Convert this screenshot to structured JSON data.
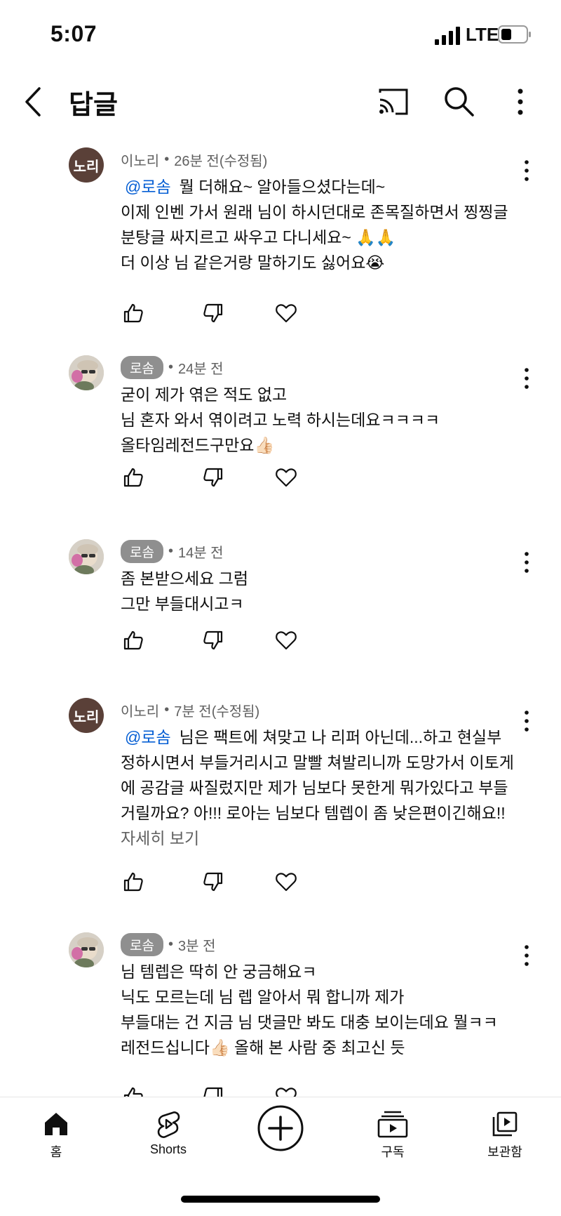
{
  "status": {
    "time": "5:07",
    "network": "LTE"
  },
  "header": {
    "title": "답글"
  },
  "comments": [
    {
      "author": "이노리",
      "author_style": "plain",
      "avatar_text": "노리",
      "time": "26분 전(수정됨)",
      "mention": "@로솜",
      "lines": [
        "뭘 더해요~ 알아들으셨다는데~",
        "이제 인벤 가서 원래 님이 하시던대로 존목질하면서 찡찡글",
        "분탕글 싸지르고 싸우고 다니세요~ 🙏🙏",
        " 더 이상 님 같은거랑 말하기도 싫어요😭"
      ]
    },
    {
      "author": "로솜",
      "author_style": "chip",
      "time": "24분 전",
      "lines": [
        "굳이 제가 엮은 적도 없고",
        "님 혼자 와서 엮이려고 노력 하시는데요ㅋㅋㅋㅋ",
        "올타임레전드구만요👍🏻"
      ]
    },
    {
      "author": "로솜",
      "author_style": "chip",
      "time": "14분 전",
      "lines": [
        "좀 본받으세요 그럼",
        "그만 부들대시고ㅋ"
      ]
    },
    {
      "author": "이노리",
      "author_style": "plain",
      "avatar_text": "노리",
      "time": "7분 전(수정됨)",
      "mention": "@로솜",
      "lines": [
        "님은 팩트에 쳐맞고 나 리퍼 아닌데...하고 현실부",
        "정하시면서 부들거리시고 말빨 쳐발리니까 도망가서 이토게",
        "에 공감글 싸질렀지만 제가 님보다 못한게 뭐가있다고 부들",
        "거릴까요? 아!!! 로아는 님보다 템렙이 좀 낮은편이긴해요!!"
      ],
      "read_more": "자세히 보기"
    },
    {
      "author": "로솜",
      "author_style": "chip",
      "time": "3분 전",
      "lines": [
        "님 템렙은 딱히 안 궁금해요ㅋ",
        "닉도 모르는데 님 렙 알아서 뭐 합니까 제가",
        "부들대는 건 지금 님 댓글만 봐도 대충 보이는데요 뭘ㅋㅋ",
        "레전드십니다👍🏻 올해 본 사람 중 최고신 듯"
      ]
    }
  ],
  "nav": {
    "home": "홈",
    "shorts": "Shorts",
    "subscriptions": "구독",
    "library": "보관함"
  },
  "icons": {
    "header": [
      "back-icon",
      "cast-icon",
      "search-icon",
      "more-vert-icon"
    ],
    "actions": [
      "thumbs-up-icon",
      "thumbs-down-icon",
      "heart-icon"
    ],
    "nav": [
      "home-icon",
      "shorts-icon",
      "create-plus-icon",
      "subscriptions-icon",
      "library-icon"
    ]
  }
}
